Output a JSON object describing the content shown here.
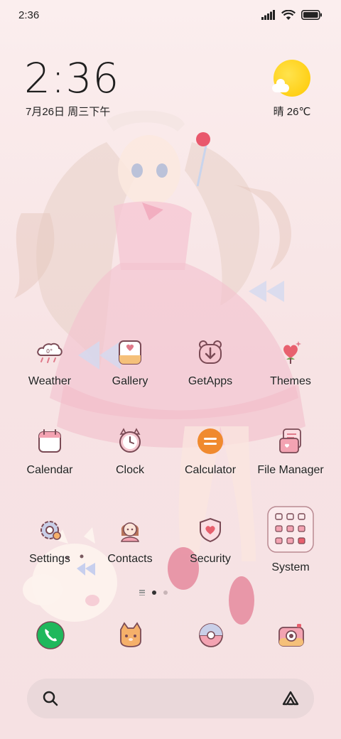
{
  "status_bar": {
    "time": "2:36",
    "icons": [
      "signal-icon",
      "wifi-icon",
      "battery-icon"
    ]
  },
  "clock_widget": {
    "time": "2:36",
    "date": "7月26日 周三下午"
  },
  "weather_widget": {
    "condition_icon": "sun-cloud-icon",
    "text": "晴 26℃"
  },
  "apps": [
    {
      "label": "Weather",
      "icon": "weather-icon"
    },
    {
      "label": "Gallery",
      "icon": "gallery-icon"
    },
    {
      "label": "GetApps",
      "icon": "getapps-icon"
    },
    {
      "label": "Themes",
      "icon": "themes-icon"
    },
    {
      "label": "Calendar",
      "icon": "calendar-icon"
    },
    {
      "label": "Clock",
      "icon": "clock-icon"
    },
    {
      "label": "Calculator",
      "icon": "calculator-icon"
    },
    {
      "label": "File Manager",
      "icon": "file-manager-icon"
    },
    {
      "label": "Settings",
      "icon": "settings-icon"
    },
    {
      "label": "Contacts",
      "icon": "contacts-icon"
    },
    {
      "label": "Security",
      "icon": "security-icon"
    },
    {
      "label": "System",
      "icon": "system-folder-icon"
    }
  ],
  "page_indicator": {
    "pages": 2,
    "active": 1
  },
  "dock": [
    "phone-icon",
    "cat-icon",
    "browser-icon",
    "camera-icon"
  ],
  "search_bar": {
    "left_icon": "search-icon",
    "right_icon": "assistant-icon"
  },
  "colors": {
    "accent_pink": "#e07a8a",
    "icon_line": "#7a4a55",
    "calculator": "#f08a2e",
    "phone": "#1fb85c",
    "sun": "#ffcc00"
  }
}
